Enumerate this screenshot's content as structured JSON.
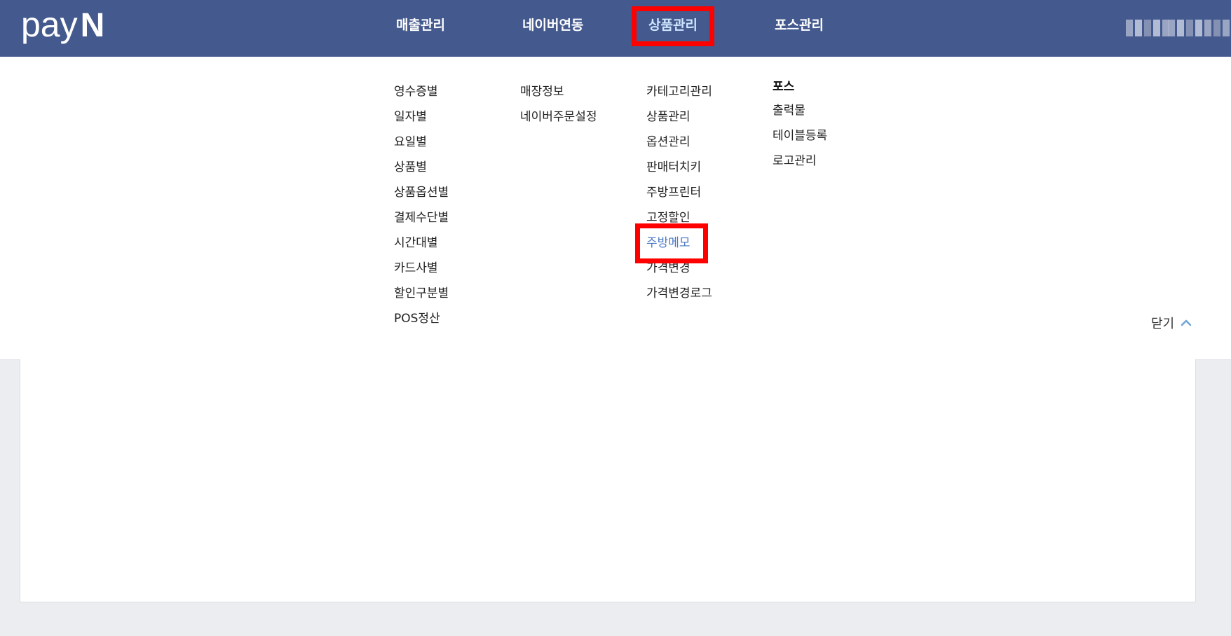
{
  "header": {
    "logo": {
      "text_main": "pay",
      "text_n": "N"
    },
    "nav": [
      {
        "label": "매출관리"
      },
      {
        "label": "네이버연동"
      },
      {
        "label": "상품관리",
        "active": true
      },
      {
        "label": "포스관리"
      }
    ]
  },
  "dropdown": {
    "sales": [
      "영수증별",
      "일자별",
      "요일별",
      "상품별",
      "상품옵션별",
      "결제수단별",
      "시간대별",
      "카드사별",
      "할인구분별",
      "POS정산"
    ],
    "naver": [
      "매장정보",
      "네이버주문설정"
    ],
    "products": [
      "카테고리관리",
      "상품관리",
      "옵션관리",
      "판매터치키",
      "주방프린터",
      "고정할인",
      "주방메모",
      "가격변경",
      "가격변경로그"
    ],
    "products_selected": "주방메모",
    "pos": {
      "heading": "포스",
      "items": [
        "출력물",
        "테이블등록",
        "로고관리"
      ]
    },
    "close_label": "닫기"
  },
  "colors": {
    "header_bg": "#445a8e",
    "active_nav": "#cfe6ff",
    "selected_item": "#4a78c4",
    "highlight": "#ff0000",
    "page_bg": "#ebedf0"
  }
}
